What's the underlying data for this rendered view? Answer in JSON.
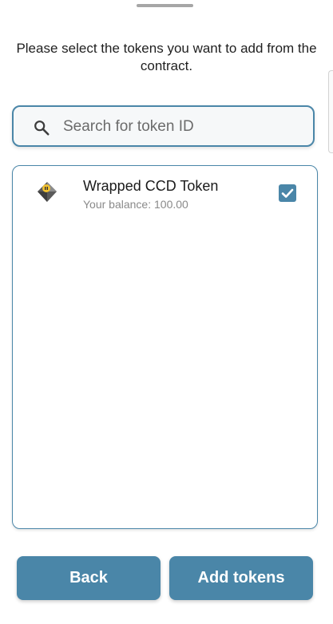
{
  "instruction": "Please select the tokens you want to add from the contract.",
  "search": {
    "placeholder": "Search for token ID",
    "value": ""
  },
  "tokens": [
    {
      "name": "Wrapped CCD Token",
      "balance": "Your balance: 100.00",
      "selected": true,
      "icon": "wrapped-ccd-token-icon"
    }
  ],
  "buttons": {
    "back_label": "Back",
    "add_label": "Add tokens"
  },
  "colors": {
    "accent": "#4a86a8",
    "muted_text": "#8a8a8a"
  }
}
